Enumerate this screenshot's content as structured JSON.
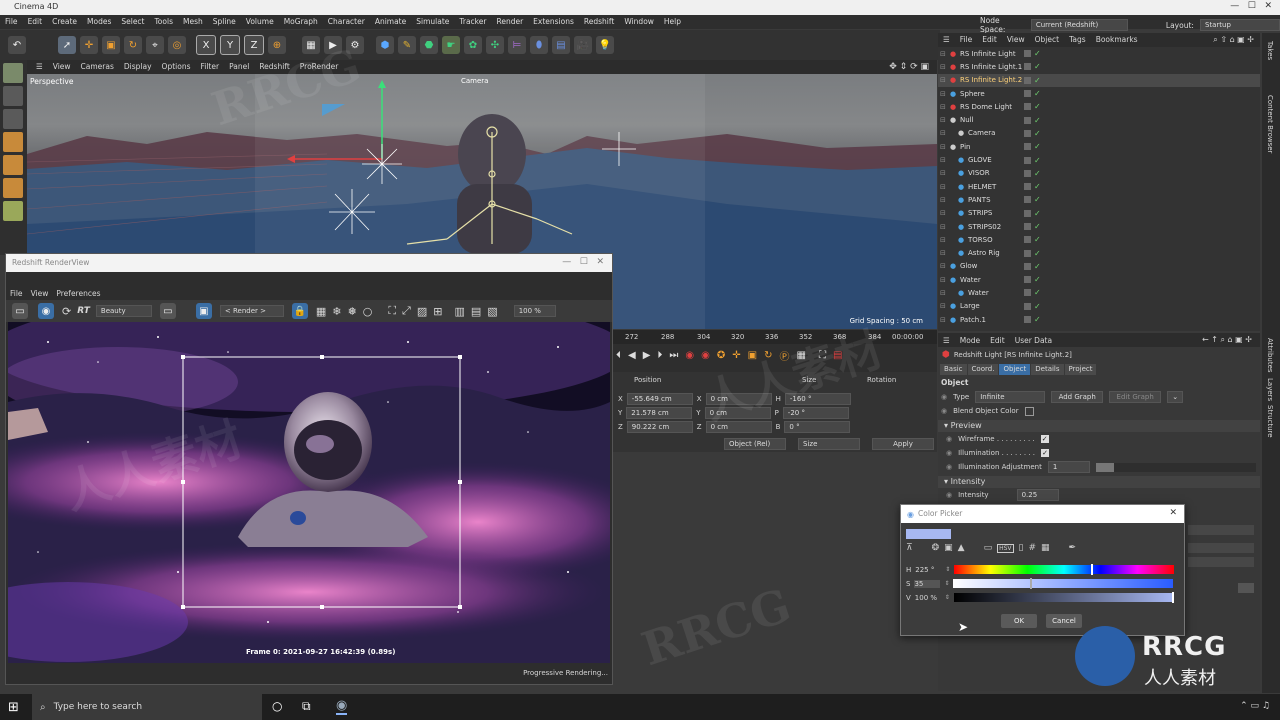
{
  "app": {
    "title": "Cinema 4D"
  },
  "menubar": [
    "File",
    "Edit",
    "Create",
    "Modes",
    "Select",
    "Tools",
    "Mesh",
    "Spline",
    "Volume",
    "MoGraph",
    "Character",
    "Animate",
    "Simulate",
    "Tracker",
    "Render",
    "Extensions",
    "Redshift",
    "Window",
    "Help"
  ],
  "node_space": {
    "label": "Node Space:",
    "value": "Current (Redshift)"
  },
  "layout": {
    "label": "Layout:",
    "value": "Startup"
  },
  "toolbar_axes": [
    "X",
    "Y",
    "Z"
  ],
  "viewport": {
    "menu": [
      "View",
      "Cameras",
      "Display",
      "Options",
      "Filter",
      "Panel",
      "Redshift",
      "ProRender"
    ],
    "label": "Perspective",
    "camera_label": "Camera",
    "grid_spacing": "Grid Spacing : 50 cm"
  },
  "renderview": {
    "title": "Redshift RenderView",
    "menu": [
      "File",
      "View",
      "Preferences"
    ],
    "rt_label": "RT",
    "aov": "Beauty",
    "render_dropdown": "< Render >",
    "zoom": "100 %",
    "frame_info": "Frame  0:  2021-09-27  16:42:39  (0.89s)",
    "status": "Progressive Rendering..."
  },
  "timeline": {
    "ticks": [
      "272",
      "288",
      "304",
      "320",
      "336",
      "352",
      "368",
      "384"
    ],
    "time": "00:00:00"
  },
  "coordinates": {
    "headers": [
      "Position",
      "Size",
      "Rotation"
    ],
    "rows": [
      {
        "axis": "X",
        "pos": "-55.649 cm",
        "saxis": "X",
        "size": "0 cm",
        "raxis": "H",
        "rot": "-160 °"
      },
      {
        "axis": "Y",
        "pos": "21.578 cm",
        "saxis": "Y",
        "size": "0 cm",
        "raxis": "P",
        "rot": "-20 °"
      },
      {
        "axis": "Z",
        "pos": "90.222 cm",
        "saxis": "Z",
        "size": "0 cm",
        "raxis": "B",
        "rot": "0 °"
      }
    ],
    "mode": "Object (Rel)",
    "size_mode": "Size",
    "apply": "Apply"
  },
  "object_manager": {
    "menu": [
      "File",
      "Edit",
      "View",
      "Object",
      "Tags",
      "Bookmarks"
    ],
    "objects": [
      {
        "name": "RS Infinite Light",
        "indent": 0,
        "icon": "#e04040",
        "selected": false
      },
      {
        "name": "RS Infinite Light.1",
        "indent": 0,
        "icon": "#e04040",
        "selected": false
      },
      {
        "name": "RS Infinite Light.2",
        "indent": 0,
        "icon": "#e04040",
        "selected": true
      },
      {
        "name": "Sphere",
        "indent": 0,
        "icon": "#4aa0e0",
        "selected": false
      },
      {
        "name": "RS Dome Light",
        "indent": 0,
        "icon": "#e04040",
        "selected": false
      },
      {
        "name": "Null",
        "indent": 0,
        "icon": "#cccccc",
        "selected": false
      },
      {
        "name": "Camera",
        "indent": 1,
        "icon": "#cccccc",
        "selected": false
      },
      {
        "name": "Pin",
        "indent": 0,
        "icon": "#cccccc",
        "selected": false
      },
      {
        "name": "GLOVE",
        "indent": 1,
        "icon": "#4aa0e0",
        "selected": false
      },
      {
        "name": "VISOR",
        "indent": 1,
        "icon": "#4aa0e0",
        "selected": false
      },
      {
        "name": "HELMET",
        "indent": 1,
        "icon": "#4aa0e0",
        "selected": false
      },
      {
        "name": "PANTS",
        "indent": 1,
        "icon": "#4aa0e0",
        "selected": false
      },
      {
        "name": "STRIPS",
        "indent": 1,
        "icon": "#4aa0e0",
        "selected": false
      },
      {
        "name": "STRIPS02",
        "indent": 1,
        "icon": "#4aa0e0",
        "selected": false
      },
      {
        "name": "TORSO",
        "indent": 1,
        "icon": "#4aa0e0",
        "selected": false
      },
      {
        "name": "Astro Rig",
        "indent": 1,
        "icon": "#4aa0e0",
        "selected": false
      },
      {
        "name": "Glow",
        "indent": 0,
        "icon": "#4aa0e0",
        "selected": false
      },
      {
        "name": "Water",
        "indent": 0,
        "icon": "#4aa0e0",
        "selected": false
      },
      {
        "name": "Water",
        "indent": 1,
        "icon": "#4aa0e0",
        "selected": false
      },
      {
        "name": "Large",
        "indent": 0,
        "icon": "#4aa0e0",
        "selected": false
      },
      {
        "name": "Patch.1",
        "indent": 0,
        "icon": "#4aa0e0",
        "selected": false
      }
    ]
  },
  "attributes": {
    "menu": [
      "Mode",
      "Edit",
      "User Data"
    ],
    "object_title": "Redshift Light [RS Infinite Light.2]",
    "tabs": [
      "Basic",
      "Coord.",
      "Object",
      "Details",
      "Project"
    ],
    "active_tab": "Object",
    "section": "Object",
    "type_label": "Type",
    "type_value": "Infinite",
    "add_graph": "Add Graph",
    "edit_graph": "Edit Graph",
    "blend_label": "Blend Object Color",
    "preview_section": "Preview",
    "wireframe_label": "Wireframe . . . . . . . . .",
    "illumination_label": "Illumination . . . . . . . .",
    "illum_adjust_label": "Illumination Adjustment",
    "illum_adjust_value": "1",
    "intensity_section": "Intensity",
    "intensity_label": "Intensity",
    "intensity_value": "0.25"
  },
  "color_picker": {
    "title": "Color Picker",
    "swatch": "#a7b8f2",
    "h_label": "H",
    "h_value": "225 °",
    "s_label": "S",
    "s_value": "35",
    "v_label": "V",
    "v_value": "100 %",
    "ok": "OK",
    "cancel": "Cancel"
  },
  "right_strip": [
    "Takes",
    "Content Browser",
    "Attributes",
    "Layers",
    "Structure"
  ],
  "taskbar": {
    "search_placeholder": "Type here to search"
  },
  "watermarks": [
    "RRCG",
    "人人素材"
  ]
}
